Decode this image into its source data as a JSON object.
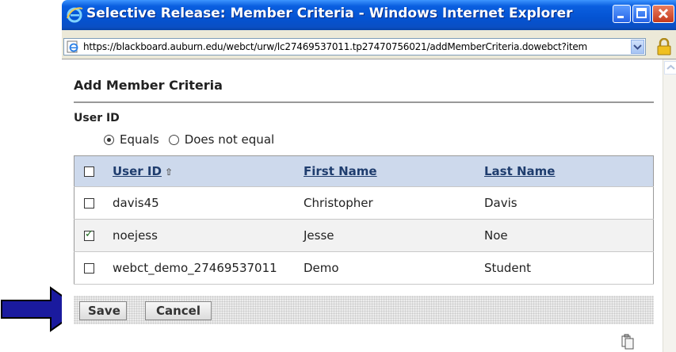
{
  "window": {
    "title": "Selective Release: Member Criteria - Windows Internet Explorer",
    "url": "https://blackboard.auburn.edu/webct/urw/lc27469537011.tp27470756021/addMemberCriteria.dowebct?item"
  },
  "page": {
    "heading": "Add Member Criteria",
    "section_label": "User ID",
    "radio_equals": "Equals",
    "radio_not_equal": "Does not equal"
  },
  "table": {
    "headers": [
      "User ID",
      "First Name",
      "Last Name"
    ],
    "rows": [
      {
        "user_id": "davis45",
        "first": "Christopher",
        "last": "Davis",
        "checked": false
      },
      {
        "user_id": "noejess",
        "first": "Jesse",
        "last": "Noe",
        "checked": true
      },
      {
        "user_id": "webct_demo_27469537011",
        "first": "Demo",
        "last": "Student",
        "checked": false
      }
    ]
  },
  "buttons": {
    "save": "Save",
    "cancel": "Cancel"
  },
  "colors": {
    "titlebar": "#0453d2",
    "header_row": "#cdd9ec",
    "arrow": "#1a1a9e"
  }
}
